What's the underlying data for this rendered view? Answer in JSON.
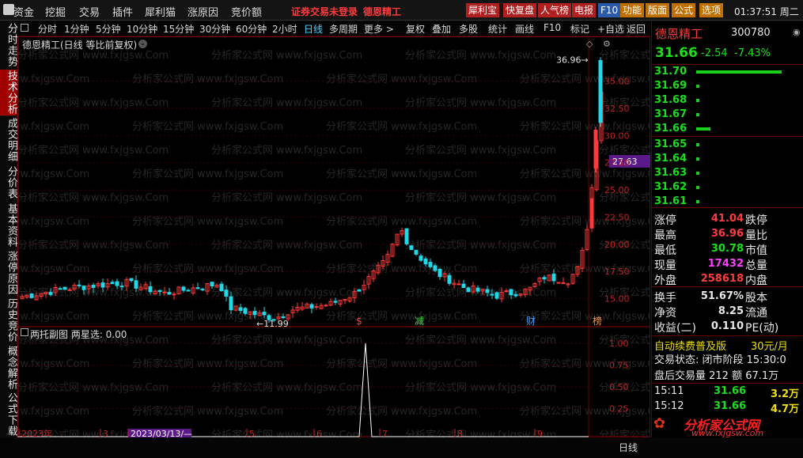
{
  "menubar": {
    "items": [
      "资金",
      "挖掘",
      "交易",
      "插件",
      "犀利猫",
      "涨原因",
      "竞价额"
    ],
    "warning": "证券交易未登录",
    "stock_name": "德恩精工",
    "buttons": [
      "犀利宝",
      "快复盘",
      "人气榜",
      "电报",
      "F10",
      "功能",
      "版面",
      "公式",
      "选项"
    ],
    "clock": "01:37:51 周二"
  },
  "left_tabs": [
    "分时走势",
    "技术分析",
    "成交明细",
    "分价表",
    "基本资料",
    "涨停原因",
    "历史竞价",
    "概念解析",
    "公式下载"
  ],
  "periods": [
    "分时",
    "1分钟",
    "5分钟",
    "10分钟",
    "15分钟",
    "30分钟",
    "60分钟",
    "2小时",
    "日线",
    "多周期",
    "更多 >",
    "复权",
    "叠加",
    "多股",
    "统计",
    "画线",
    "F10",
    "标记",
    "+自选",
    "返回"
  ],
  "selected_period": "日线",
  "chart": {
    "title": "德恩精工(日线 等比前复权)",
    "sub_title": "两托副图 两星选: 0.00",
    "watermark": "分析家公式网 www.fxjgsw.Com",
    "last_price_tag": "27.63",
    "high_label": "36.96",
    "low_label": "11.99",
    "sub_axis": [
      "1.00",
      "0.75",
      "0.50",
      "0.25"
    ],
    "event_marks": [
      "$",
      "减",
      "财",
      "榜"
    ],
    "date_labels": [
      "2023年",
      "3",
      "2023/03/13/—",
      "5",
      "6",
      "7",
      "8",
      "9"
    ],
    "period_tab": "日线"
  },
  "chart_data": {
    "type": "candlestick",
    "y_ticks": [
      "35.00",
      "32.50",
      "30.00",
      "27.50",
      "25.00",
      "22.50",
      "20.00",
      "17.50",
      "15.00"
    ],
    "ylim": [
      12.5,
      37.8
    ]
  },
  "quote": {
    "name": "德恩精工",
    "code": "300780",
    "price": "31.66",
    "change": "-2.54",
    "pct": "-7.43%",
    "order_book": [
      {
        "p": "31.70",
        "v": "大",
        "c": "green"
      },
      {
        "p": "31.69",
        "v": "",
        "c": "green"
      },
      {
        "p": "31.68",
        "v": "",
        "c": "green"
      },
      {
        "p": "31.67",
        "v": "",
        "c": "green"
      },
      {
        "p": "31.66",
        "v": "",
        "c": "green"
      },
      {
        "p": "31.65",
        "v": "",
        "c": "green"
      },
      {
        "p": "31.64",
        "v": "",
        "c": "green"
      },
      {
        "p": "31.63",
        "v": "",
        "c": "green"
      },
      {
        "p": "31.62",
        "v": "",
        "c": "green"
      },
      {
        "p": "31.61",
        "v": "",
        "c": "green"
      }
    ],
    "stats": [
      {
        "l": "涨停",
        "v": "41.04",
        "vc": "red",
        "r": "跌停"
      },
      {
        "l": "最高",
        "v": "36.96",
        "vc": "red",
        "r": "量比"
      },
      {
        "l": "最低",
        "v": "30.78",
        "vc": "green",
        "r": "市值"
      },
      {
        "l": "现量",
        "v": "17432",
        "vc": "mag",
        "r": "总量"
      },
      {
        "l": "外盘",
        "v": "258618",
        "vc": "red",
        "r": "内盘"
      },
      {
        "l": "换手",
        "v": "51.67%",
        "vc": "wht",
        "r": "股本"
      },
      {
        "l": "净资",
        "v": "8.25",
        "vc": "wht",
        "r": "流通"
      },
      {
        "l": "收益(二)",
        "v": "0.110",
        "vc": "wht",
        "r": "PE(动)"
      }
    ],
    "promo": "自动续费普及版",
    "promo_price": "30元/月",
    "trade_state": "交易状态: 闭市阶段 15:30:0",
    "after_trade": "盘后交易量 212 额 67.1万",
    "ticks": [
      {
        "t": "15:11",
        "p": "31.66",
        "v": "3.2万"
      },
      {
        "t": "15:12",
        "p": "31.66",
        "v": "4.7万"
      }
    ],
    "site_name": "分析家公式网",
    "site_url": "www.fxjgsw.com"
  }
}
